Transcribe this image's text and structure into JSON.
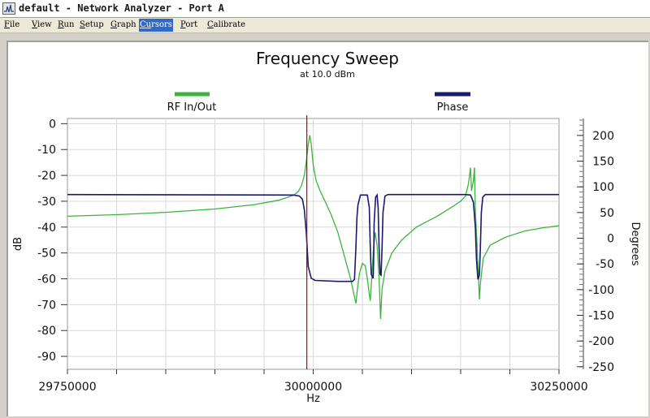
{
  "window": {
    "title": "default - Network Analyzer - Port A"
  },
  "menu": [
    {
      "mnemonic": "F",
      "rest": "ile"
    },
    {
      "mnemonic": "V",
      "rest": "iew"
    },
    {
      "mnemonic": "R",
      "rest": "un"
    },
    {
      "mnemonic": "S",
      "rest": "etup"
    },
    {
      "mnemonic": "G",
      "rest": "raph"
    },
    {
      "mnemonic": "Cu",
      "rest": "rsors",
      "active": true
    },
    {
      "mnemonic": "P",
      "rest": "ort"
    },
    {
      "mnemonic": "C",
      "rest": "alibrate"
    }
  ],
  "colors": {
    "rf_trace": "#3cb43c",
    "phase_trace": "#1a1a6e",
    "cursor": "#c00000",
    "grid": "#d8d8d8",
    "plot_bg": "#ffffff"
  },
  "chart_data": {
    "type": "line",
    "title": "Frequency Sweep",
    "subtitle": "at 10.0 dBm",
    "xlabel": "Hz",
    "ylabel_left": "dB",
    "ylabel_right": "Degrees",
    "xlim": [
      29750000,
      30250000
    ],
    "ylim_left": [
      -95,
      2
    ],
    "ylim_right": [
      -255,
      233
    ],
    "x_ticks": [
      29750000,
      30000000,
      30250000
    ],
    "y_ticks_left": [
      0,
      -10,
      -20,
      -30,
      -40,
      -50,
      -60,
      -70,
      -80,
      -90
    ],
    "y_ticks_right": [
      200,
      150,
      100,
      50,
      0,
      -50,
      -100,
      -150,
      -200,
      -250
    ],
    "legend": [
      {
        "name": "RF In/Out",
        "axis": "left"
      },
      {
        "name": "Phase",
        "axis": "right"
      }
    ],
    "cursor_x": 29993500,
    "grid": true,
    "series": [
      {
        "name": "RF In/Out",
        "axis": "left",
        "points": [
          [
            29750000,
            -35.8
          ],
          [
            29800000,
            -35.2
          ],
          [
            29850000,
            -34.3
          ],
          [
            29900000,
            -33.0
          ],
          [
            29940000,
            -31.3
          ],
          [
            29965000,
            -29.6
          ],
          [
            29980000,
            -27.7
          ],
          [
            29985000,
            -26.2
          ],
          [
            29988000,
            -24.0
          ],
          [
            29991000,
            -20.0
          ],
          [
            29993000,
            -14.5
          ],
          [
            29995000,
            -8.0
          ],
          [
            29996500,
            -4.5
          ],
          [
            29998000,
            -8.0
          ],
          [
            30000000,
            -16.0
          ],
          [
            30003000,
            -22.0
          ],
          [
            30007000,
            -26.0
          ],
          [
            30012000,
            -30.0
          ],
          [
            30018000,
            -35.0
          ],
          [
            30025000,
            -42.0
          ],
          [
            30033000,
            -53.0
          ],
          [
            30038000,
            -60.0
          ],
          [
            30042000,
            -67.0
          ],
          [
            30043500,
            -69.5
          ],
          [
            30045000,
            -64.0
          ],
          [
            30047000,
            -58.0
          ],
          [
            30050000,
            -54.0
          ],
          [
            30053000,
            -55.0
          ],
          [
            30055000,
            -60.0
          ],
          [
            30057000,
            -66.0
          ],
          [
            30058000,
            -68.5
          ],
          [
            30059500,
            -60.0
          ],
          [
            30061000,
            -50.0
          ],
          [
            30063000,
            -42.0
          ],
          [
            30065000,
            -47.0
          ],
          [
            30067000,
            -60.0
          ],
          [
            30068500,
            -75.5
          ],
          [
            30070000,
            -64.0
          ],
          [
            30073000,
            -57.0
          ],
          [
            30080000,
            -50.0
          ],
          [
            30090000,
            -45.0
          ],
          [
            30105000,
            -40.0
          ],
          [
            30125000,
            -36.0
          ],
          [
            30140000,
            -32.5
          ],
          [
            30150000,
            -30.0
          ],
          [
            30155000,
            -28.0
          ],
          [
            30158000,
            -23.0
          ],
          [
            30160000,
            -17.0
          ],
          [
            30161000,
            -26.0
          ],
          [
            30162000,
            -24.0
          ],
          [
            30163000,
            -22.0
          ],
          [
            30164000,
            -17.0
          ],
          [
            30165000,
            -34.0
          ],
          [
            30166500,
            -46.0
          ],
          [
            30168000,
            -58.0
          ],
          [
            30169000,
            -68.0
          ],
          [
            30170000,
            -62.0
          ],
          [
            30173000,
            -52.0
          ],
          [
            30180000,
            -47.0
          ],
          [
            30195000,
            -44.0
          ],
          [
            30215000,
            -41.5
          ],
          [
            30235000,
            -40.2
          ],
          [
            30250000,
            -39.5
          ]
        ]
      },
      {
        "name": "Phase",
        "axis": "right",
        "points": [
          [
            29750000,
            85
          ],
          [
            29980000,
            84
          ],
          [
            29986000,
            82
          ],
          [
            29989000,
            76
          ],
          [
            29991000,
            55
          ],
          [
            29993000,
            10
          ],
          [
            29995000,
            -55
          ],
          [
            29998000,
            -78
          ],
          [
            30002000,
            -82
          ],
          [
            30025000,
            -84
          ],
          [
            30040000,
            -84
          ],
          [
            30042000,
            -80
          ],
          [
            30043500,
            -15
          ],
          [
            30044500,
            40
          ],
          [
            30045500,
            65
          ],
          [
            30048000,
            84
          ],
          [
            30055000,
            84
          ],
          [
            30057000,
            60
          ],
          [
            30058000,
            -15
          ],
          [
            30059000,
            -70
          ],
          [
            30061000,
            -78
          ],
          [
            30061500,
            -40
          ],
          [
            30062000,
            30
          ],
          [
            30063500,
            80
          ],
          [
            30065000,
            84
          ],
          [
            30066000,
            60
          ],
          [
            30067000,
            -20
          ],
          [
            30068000,
            -70
          ],
          [
            30069000,
            -72
          ],
          [
            30070000,
            -20
          ],
          [
            30071000,
            50
          ],
          [
            30073000,
            82
          ],
          [
            30076000,
            85
          ],
          [
            30155000,
            85
          ],
          [
            30160000,
            84
          ],
          [
            30163000,
            70
          ],
          [
            30165000,
            20
          ],
          [
            30166000,
            -40
          ],
          [
            30167500,
            -80
          ],
          [
            30169000,
            -72
          ],
          [
            30170000,
            -20
          ],
          [
            30171000,
            50
          ],
          [
            30172500,
            80
          ],
          [
            30175000,
            85
          ],
          [
            30250000,
            85
          ]
        ]
      }
    ]
  }
}
